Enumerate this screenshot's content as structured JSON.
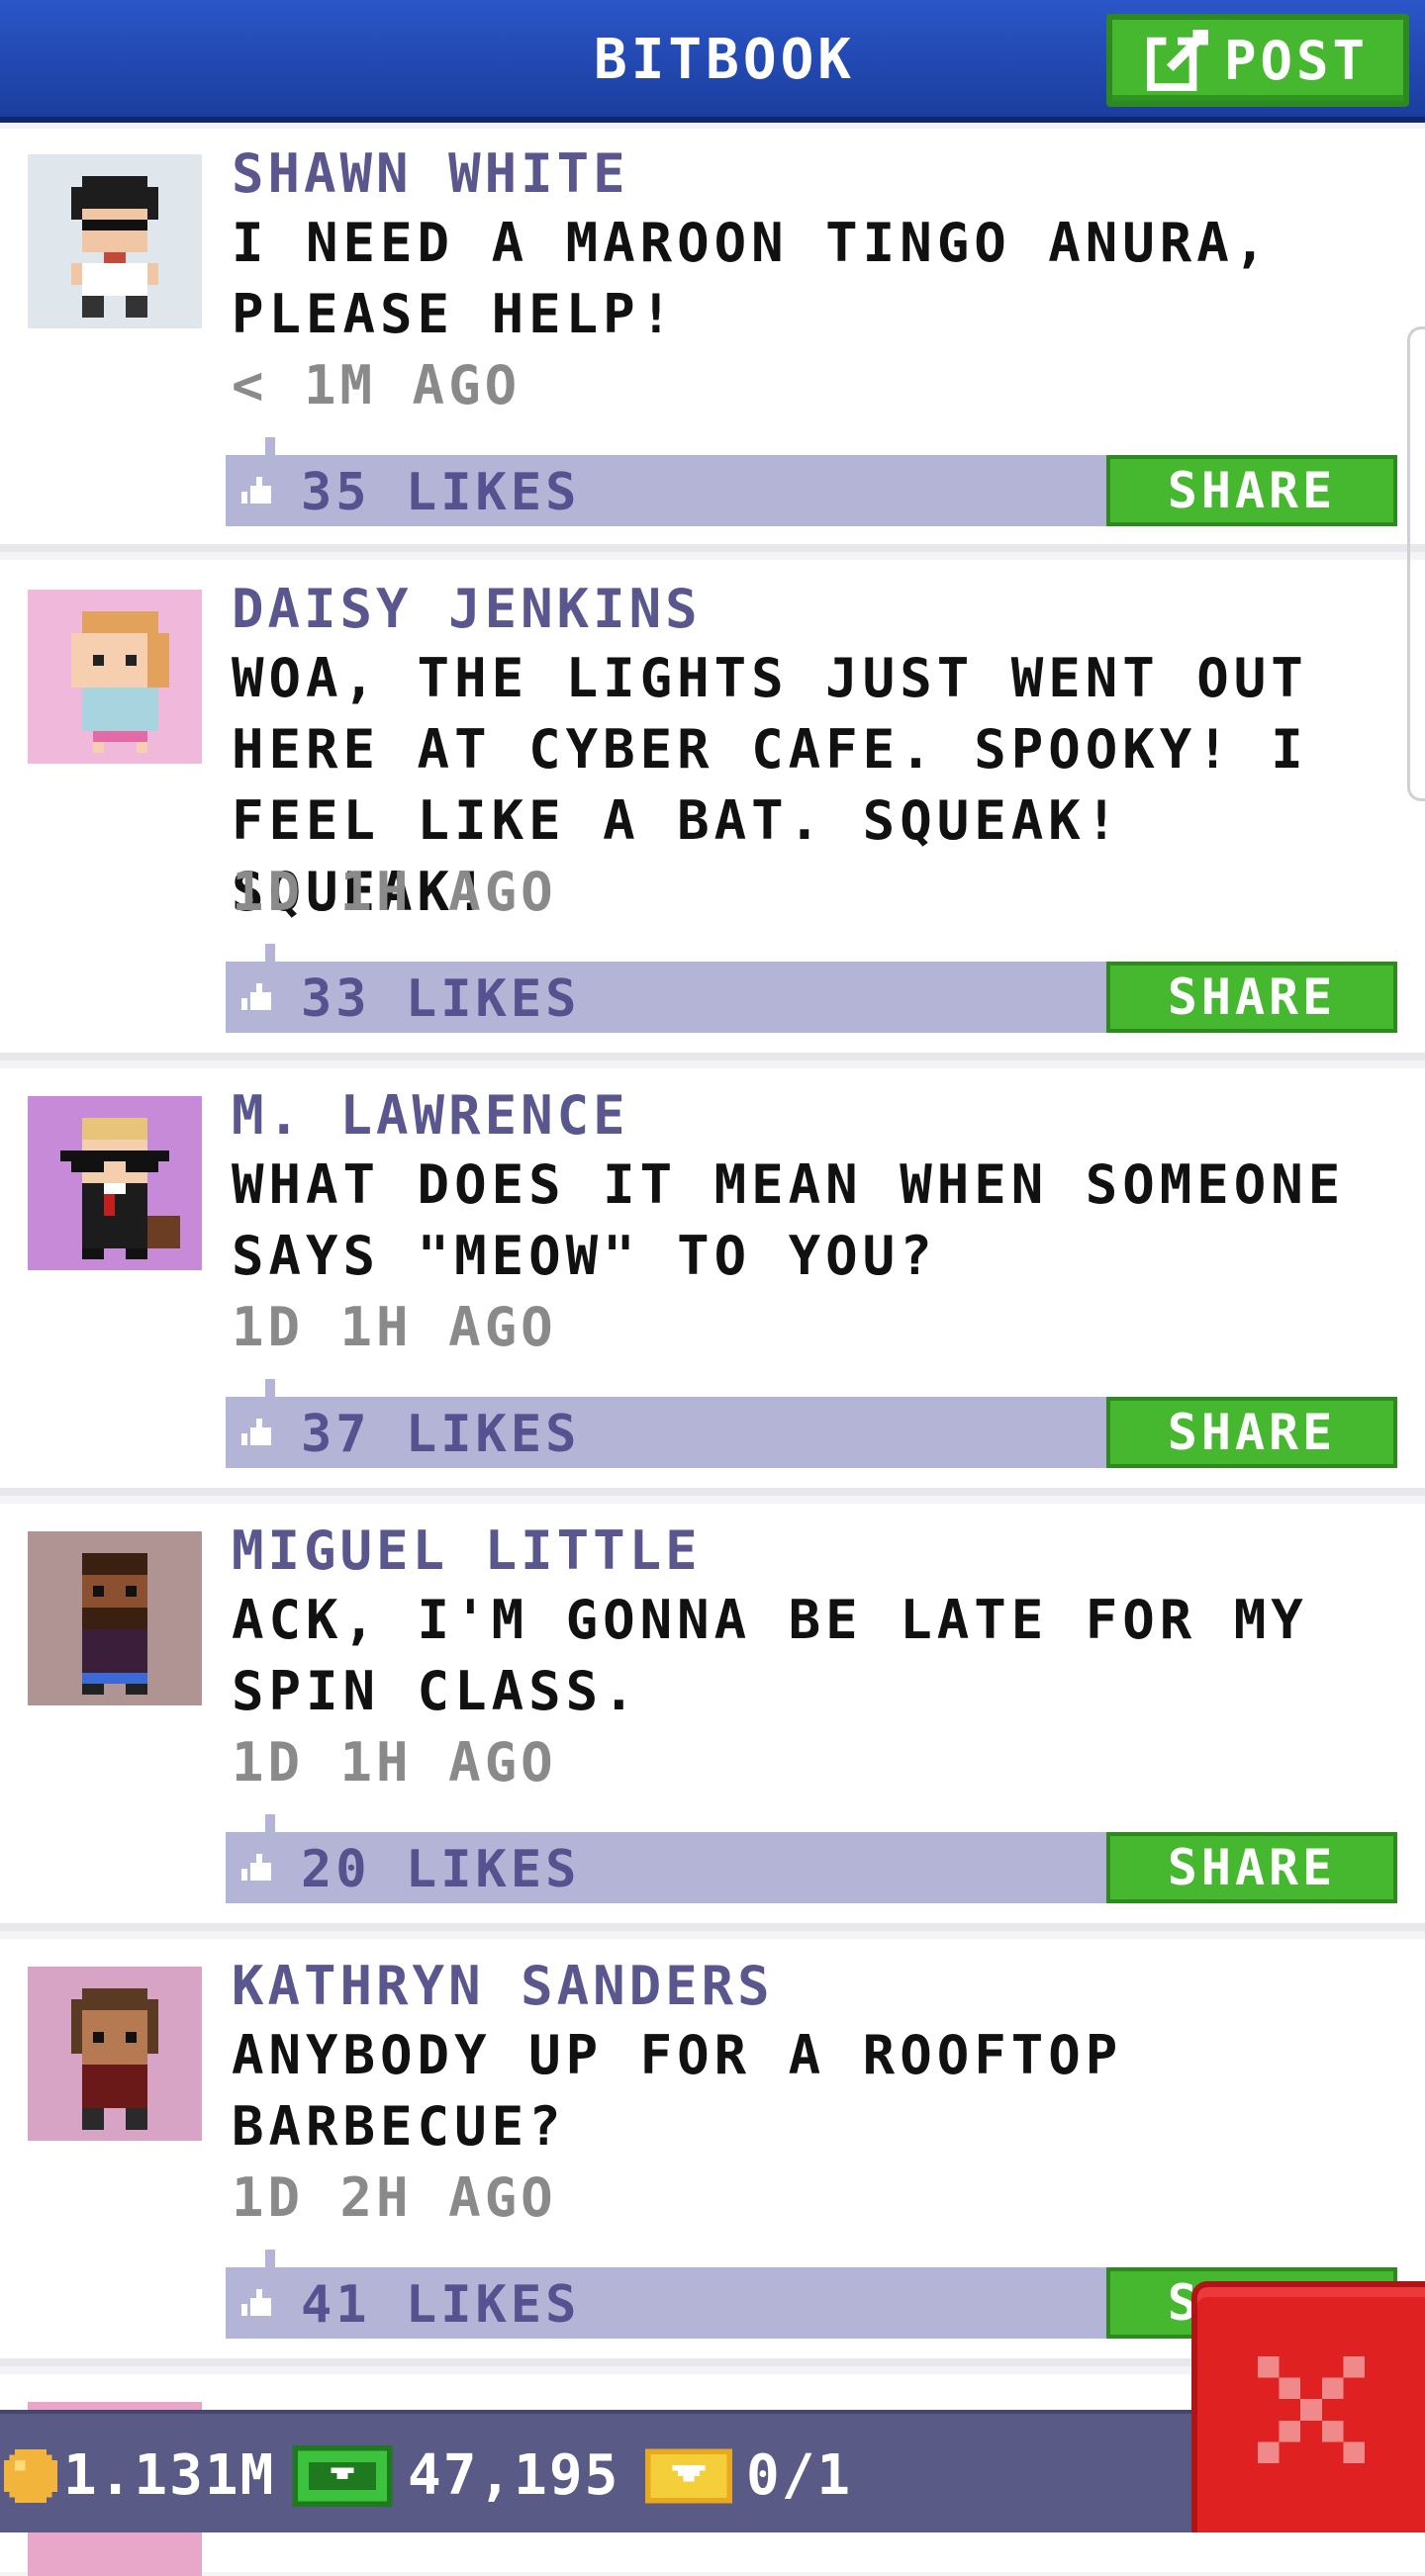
{
  "header": {
    "title": "BITBOOK",
    "post_label": "POST"
  },
  "posts": [
    {
      "author": "SHAWN WHITE",
      "message": "I NEED A MAROON TINGO ANURA, PLEASE HELP!",
      "time": "< 1M AGO",
      "likes": "35 LIKES",
      "share": "SHARE"
    },
    {
      "author": "DAISY JENKINS",
      "message": "WOA, THE LIGHTS JUST WENT OUT HERE AT CYBER CAFE. SPOOKY! I FEEL LIKE A BAT. SQUEAK! SQUEAK!",
      "time": "1D 1H AGO",
      "likes": "33 LIKES",
      "share": "SHARE"
    },
    {
      "author": "M. LAWRENCE",
      "message": "WHAT DOES IT MEAN WHEN SOMEONE SAYS \"MEOW\" TO YOU?",
      "time": "1D 1H AGO",
      "likes": "37 LIKES",
      "share": "SHARE"
    },
    {
      "author": "MIGUEL LITTLE",
      "message": "ACK, I'M GONNA BE LATE FOR MY SPIN CLASS.",
      "time": "1D 1H AGO",
      "likes": "20 LIKES",
      "share": "SHARE"
    },
    {
      "author": "KATHRYN SANDERS",
      "message": "ANYBODY UP FOR A ROOFTOP BARBECUE?",
      "time": "1D 2H AGO",
      "likes": "41 LIKES",
      "share": "SHARE"
    }
  ],
  "status_bar": {
    "coins": "1.131M",
    "bux": "47,195",
    "tickets": "0/1"
  },
  "colors": {
    "header_blue": "#2b56c8",
    "button_green": "#45b82f",
    "like_bar": "#b4b4d6",
    "author_purple": "#5a578f",
    "close_red": "#e02121"
  },
  "icons": {
    "post": "edit-icon",
    "like": "thumbs-up-icon",
    "coins": "coin-icon",
    "bux": "bux-icon",
    "tickets": "ticket-icon",
    "close": "close-icon"
  }
}
